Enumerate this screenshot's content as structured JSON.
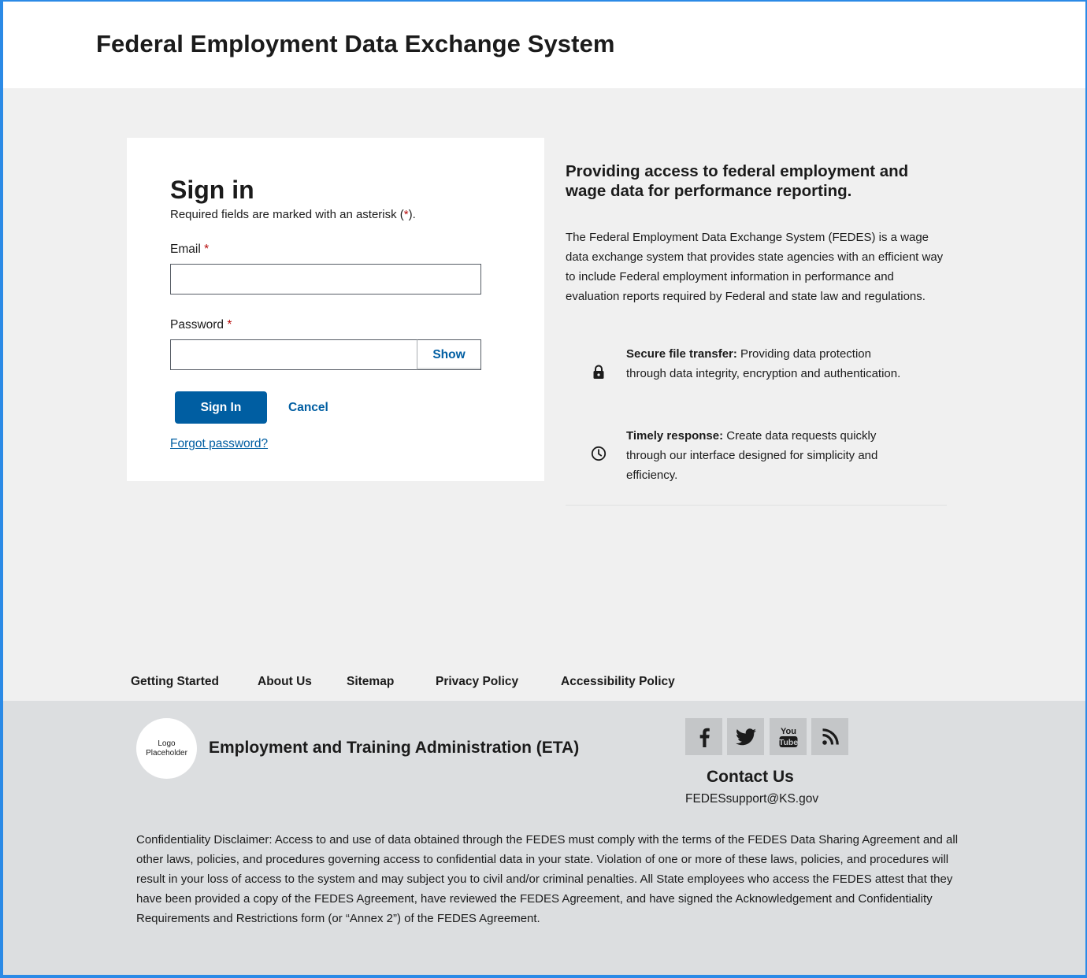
{
  "header": {
    "title": "Federal Employment Data Exchange System"
  },
  "signin": {
    "heading": "Sign in",
    "required_note_prefix": "Required fields are marked with an asterisk (",
    "asterisk": "*",
    "required_note_suffix": ").",
    "email_label": "Email",
    "email_value": "",
    "password_label": "Password",
    "password_value": "",
    "show_label": "Show",
    "signin_label": "Sign In",
    "cancel_label": "Cancel",
    "forgot_label": "Forgot password?"
  },
  "info": {
    "heading": "Providing access to federal employment and wage data for performance reporting.",
    "description": "The Federal Employment Data Exchange System (FEDES) is a wage data exchange system that provides state agencies with an efficient way to include Federal employment information in performance and evaluation reports required by Federal and state law and regulations.",
    "features": [
      {
        "icon": "lock-icon",
        "title": "Secure file transfer:",
        "text": " Providing data protection through data integrity, encryption and authentication."
      },
      {
        "icon": "clock-icon",
        "title": "Timely response:",
        "text": " Create data requests quickly through our interface designed for simplicity and efficiency."
      }
    ]
  },
  "footer_nav": [
    "Getting Started",
    "About Us",
    "Sitemap",
    "Privacy Policy",
    "Accessibility Policy"
  ],
  "footer": {
    "logo_text": "Logo Placeholder",
    "agency": "Employment and Training Administration (ETA)",
    "social": [
      "facebook-icon",
      "twitter-icon",
      "youtube-icon",
      "rss-icon"
    ],
    "contact_title": "Contact Us",
    "contact_email": "FEDESsupport@KS.gov",
    "disclaimer": "Confidentiality Disclaimer: Access to and use of data obtained through the FEDES must comply with the terms of the FEDES Data Sharing Agreement and all other laws, policies, and procedures governing access to confidential data in your state. Violation of one or more of these laws, policies, and procedures will result in your loss of access to the system and may subject you to civil and/or criminal penalties. All State employees who access the FEDES attest that they have been provided a copy of the FEDES Agreement, have reviewed the FEDES Agreement, and have signed the Acknowledgement and Confidentiality Requirements and Restrictions form (or “Annex 2”) of the FEDES Agreement."
  },
  "colors": {
    "primary": "#005ea2",
    "asterisk": "#b50909",
    "footer_bg": "#dcdee0",
    "page_bg": "#f0f0f0"
  }
}
